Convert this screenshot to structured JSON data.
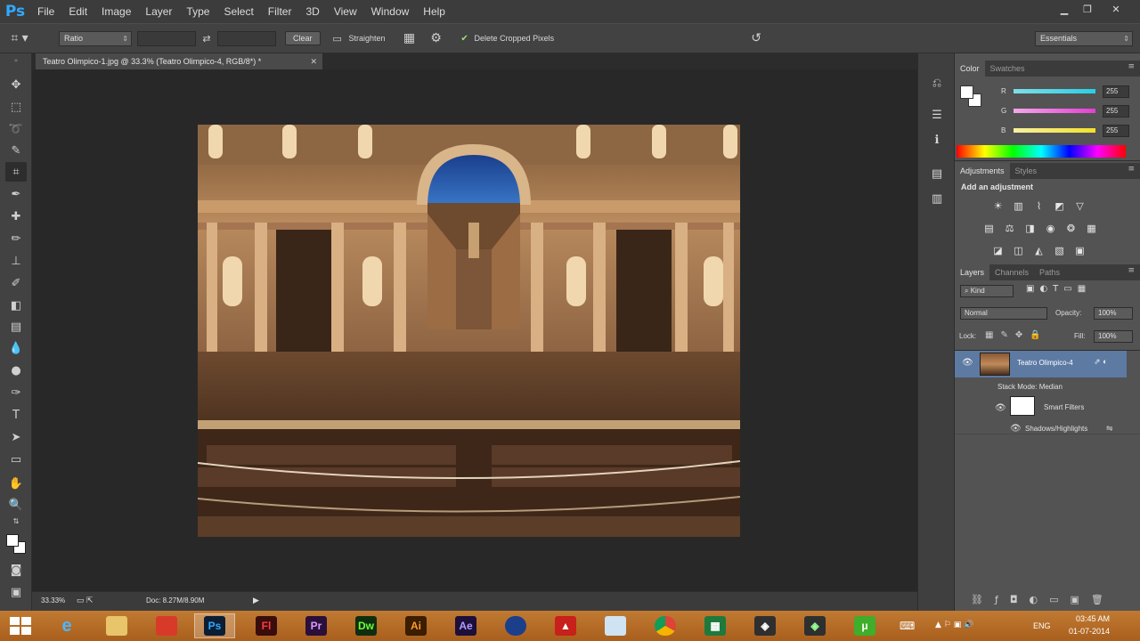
{
  "app": {
    "logo": "Ps"
  },
  "menu": [
    "File",
    "Edit",
    "Image",
    "Layer",
    "Type",
    "Select",
    "Filter",
    "3D",
    "View",
    "Window",
    "Help"
  ],
  "options": {
    "ratio": "Ratio",
    "clear": "Clear",
    "straighten": "Straighten",
    "delete_cropped": "Delete Cropped Pixels",
    "workspace": "Essentials"
  },
  "document": {
    "tab_title": "Teatro Olimpico-1.jpg @ 33.3% (Teatro Olimpico-4, RGB/8*) *",
    "zoom": "33.33%",
    "doc_size": "Doc: 8.27M/8.90M"
  },
  "color_panel": {
    "tabs": [
      "Color",
      "Swatches"
    ],
    "channels": [
      {
        "label": "R",
        "value": "255",
        "color": "#27d0e6"
      },
      {
        "label": "G",
        "value": "255",
        "color": "#e23fd3"
      },
      {
        "label": "B",
        "value": "255",
        "color": "#f2e12a"
      }
    ]
  },
  "adjustments_panel": {
    "tabs": [
      "Adjustments",
      "Styles"
    ],
    "title": "Add an adjustment"
  },
  "layers_panel": {
    "tabs": [
      "Layers",
      "Channels",
      "Paths"
    ],
    "filter_kind": "Kind",
    "blend_mode": "Normal",
    "opacity_label": "Opacity:",
    "opacity": "100%",
    "lock_label": "Lock:",
    "fill_label": "Fill:",
    "fill": "100%",
    "layer_name": "Teatro Olimpico-4",
    "stack_mode": "Stack Mode: Median",
    "smart_filters": "Smart Filters",
    "filter_name": "Shadows/Highlights"
  },
  "tray": {
    "lang": "ENG",
    "time": "03:45 AM",
    "date": "01-07-2014"
  },
  "taskbar_apps": [
    {
      "name": "Flash",
      "abbr": "Fl",
      "bg": "#3a0d0d",
      "fg": "#ff3b3b"
    },
    {
      "name": "Premiere",
      "abbr": "Pr",
      "bg": "#2a0f3b",
      "fg": "#d79cff"
    },
    {
      "name": "Dreamweaver",
      "abbr": "Dw",
      "bg": "#0f2e0f",
      "fg": "#6bff3b"
    },
    {
      "name": "Illustrator",
      "abbr": "Ai",
      "bg": "#3b1d00",
      "fg": "#ff9a2e"
    },
    {
      "name": "After Effects",
      "abbr": "Ae",
      "bg": "#1d0f3b",
      "fg": "#b39cff"
    }
  ]
}
